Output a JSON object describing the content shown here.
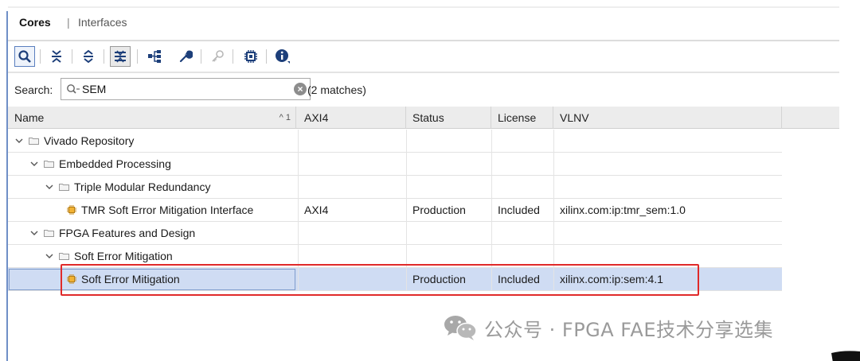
{
  "tabs": {
    "active": "Cores",
    "separator": "|",
    "inactive": "Interfaces"
  },
  "toolbar": {
    "buttons": [
      "search-icon",
      "collapse-all-icon",
      "expand-all-icon",
      "filter-icon",
      "hierarchy-icon",
      "wrench-icon",
      "key-icon",
      "chip-icon",
      "info-icon"
    ]
  },
  "search": {
    "label": "Search:",
    "value": "SEM",
    "match_count": "(2 matches)"
  },
  "table": {
    "columns": [
      "Name",
      "AXI4",
      "Status",
      "License",
      "VLNV"
    ],
    "sort_indicator": "^ 1",
    "rows": [
      {
        "level": 0,
        "kind": "folder",
        "name": "Vivado Repository",
        "axi4": "",
        "status": "",
        "license": "",
        "vlnv": ""
      },
      {
        "level": 1,
        "kind": "folder",
        "name": "Embedded Processing",
        "axi4": "",
        "status": "",
        "license": "",
        "vlnv": ""
      },
      {
        "level": 2,
        "kind": "folder",
        "name": "Triple Modular Redundancy",
        "axi4": "",
        "status": "",
        "license": "",
        "vlnv": ""
      },
      {
        "level": 3,
        "kind": "ip",
        "name": "TMR Soft Error Mitigation Interface",
        "axi4": "AXI4",
        "status": "Production",
        "license": "Included",
        "vlnv": "xilinx.com:ip:tmr_sem:1.0"
      },
      {
        "level": 1,
        "kind": "folder",
        "name": "FPGA Features and Design",
        "axi4": "",
        "status": "",
        "license": "",
        "vlnv": ""
      },
      {
        "level": 2,
        "kind": "folder",
        "name": "Soft Error Mitigation",
        "axi4": "",
        "status": "",
        "license": "",
        "vlnv": ""
      },
      {
        "level": 3,
        "kind": "ip",
        "name": "Soft Error Mitigation",
        "axi4": "",
        "status": "Production",
        "license": "Included",
        "vlnv": "xilinx.com:ip:sem:4.1",
        "selected": true
      }
    ]
  },
  "watermark": {
    "text": "公众号 · FPGA FAE技术分享选集"
  },
  "colors": {
    "selection": "#cfdcf3",
    "highlight": "#e02a2a",
    "accent": "#6f8fc7"
  }
}
